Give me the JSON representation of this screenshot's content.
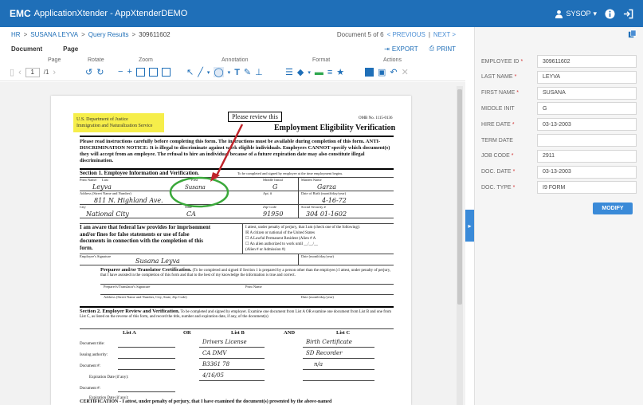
{
  "app": {
    "brand": "EMC",
    "title": "ApplicationXtender - AppXtenderDEMO",
    "user": "SYSOP"
  },
  "breadcrumb": {
    "items": [
      "HR",
      "SUSANA LEYVA",
      "Query Results",
      "309611602"
    ],
    "doc_position": "Document 5 of 6",
    "prev": "< PREVIOUS",
    "next": "NEXT >"
  },
  "tabs": {
    "document": "Document",
    "page": "Page"
  },
  "actions": {
    "export": "EXPORT",
    "print": "PRINT"
  },
  "toolbar": {
    "groups": [
      "Page",
      "Rotate",
      "Zoom",
      "Annotation",
      "Format",
      "Actions"
    ],
    "page_input": "1",
    "page_total": "/1"
  },
  "document": {
    "highlight_line1": "U.S. Department of Justice",
    "highlight_line2": "Immigration and Naturalization Service",
    "sticky_note": "Please review this",
    "omb": "OMB No. 1115-0136",
    "title": "Employment Eligibility Verification",
    "instructions": "Please read instructions carefully before completing this form. The instructions must be available during completion of this form. ANTI-DISCRIMINATION NOTICE: It is illegal to discriminate against work eligible individuals. Employers CANNOT specify which document(s) they will accept from an employee. The refusal to hire an individual because of a future expiration date may also constitute illegal discrimination.",
    "section1_title": "Section 1. Employee Information and Verification.",
    "section1_note": "To be completed and signed by employee at the time employment begins.",
    "labels": {
      "print_name": "Print Name:",
      "last": "Last",
      "first": "First",
      "middle_initial": "Middle Initial",
      "maiden_name": "Maiden Name",
      "address": "Address (Street Name and Number)",
      "apt": "Apt. #",
      "dob": "Date of Birth (month/day/year)",
      "city": "City",
      "state": "State",
      "zip": "Zip Code",
      "ssn": "Social Security #",
      "signature": "Employee's Signature",
      "date": "Date (month/day/year)"
    },
    "handwritten": {
      "last": "Leyva",
      "first": "Susana",
      "middle": "G",
      "maiden": "Garza",
      "address": "811 N. Highland Ave.",
      "dob": "4-16-72",
      "city": "National City",
      "state": "CA",
      "zip": "91950",
      "ssn": "304 01-1602",
      "signature": "Susana Leyva"
    },
    "attest": "I am aware that federal law provides for imprisonment and/or fines for false statements or use of false documents in connection with the completion of this form.",
    "attest_options": [
      "I attest, under penalty of perjury, that I am (check one of the following):",
      "A citizen or national of the United States",
      "A Lawful Permanent Resident (Alien # A",
      "An alien authorized to work until __/__/__",
      "(Alien # or Admission #)"
    ],
    "preparer_title": "Preparer and/or Translator Certification.",
    "preparer_text": "(To be completed and signed if Section 1 is prepared by a person other than the employee.) I attest, under penalty of perjury, that I have assisted in the completion of this form and that to the best of my knowledge the information is true and correct.",
    "preparer_sig": "Preparer's/Translator's Signature",
    "preparer_name": "Print Name",
    "preparer_addr": "Address (Street Name and Number, City, State, Zip Code)",
    "preparer_date": "Date (month/day/year)",
    "section2_title": "Section 2. Employer Review and Verification.",
    "section2_text": "To be completed and signed by employer. Examine one document from List A OR examine one document from List B and one from List C, as listed on the reverse of this form, and record the title, number and expiration date, if any, of the document(s)",
    "list_a": "List A",
    "or": "OR",
    "list_b": "List B",
    "and": "AND",
    "list_c": "List C",
    "row_labels": [
      "Document title:",
      "Issuing authority:",
      "Document #:",
      "Expiration Date (if any):",
      "Document #:",
      "Expiration Date (if any):"
    ],
    "list_b_values": [
      "Drivers License",
      "CA DMV",
      "B3361 78",
      "4/16/05"
    ],
    "list_c_values": [
      "Birth Certificate",
      "SD Recorder",
      "n/a"
    ],
    "certification": "CERTIFICATION - I attest, under penalty of perjury, that I have examined the document(s) presented by the above-named"
  },
  "fields": [
    {
      "label": "EMPLOYEE ID",
      "required": true,
      "value": "309611602"
    },
    {
      "label": "LAST NAME",
      "required": true,
      "value": "LEYVA"
    },
    {
      "label": "FIRST NAME",
      "required": true,
      "value": "SUSANA"
    },
    {
      "label": "MIDDLE INIT",
      "required": false,
      "value": "G"
    },
    {
      "label": "HIRE DATE",
      "required": true,
      "value": "03-13-2003"
    },
    {
      "label": "TERM DATE",
      "required": false,
      "value": ""
    },
    {
      "label": "JOB CODE",
      "required": true,
      "value": "2911"
    },
    {
      "label": "DOC. DATE",
      "required": true,
      "value": "03-13-2003"
    },
    {
      "label": "DOC. TYPE",
      "required": true,
      "value": "I9 FORM"
    }
  ],
  "modify_label": "MODIFY",
  "colors": {
    "topbar": "#1f6fb8",
    "accent": "#3a8ad8",
    "highlight": "#f6ee4a",
    "circle": "#3aa83a",
    "arrow": "#c0242a"
  }
}
